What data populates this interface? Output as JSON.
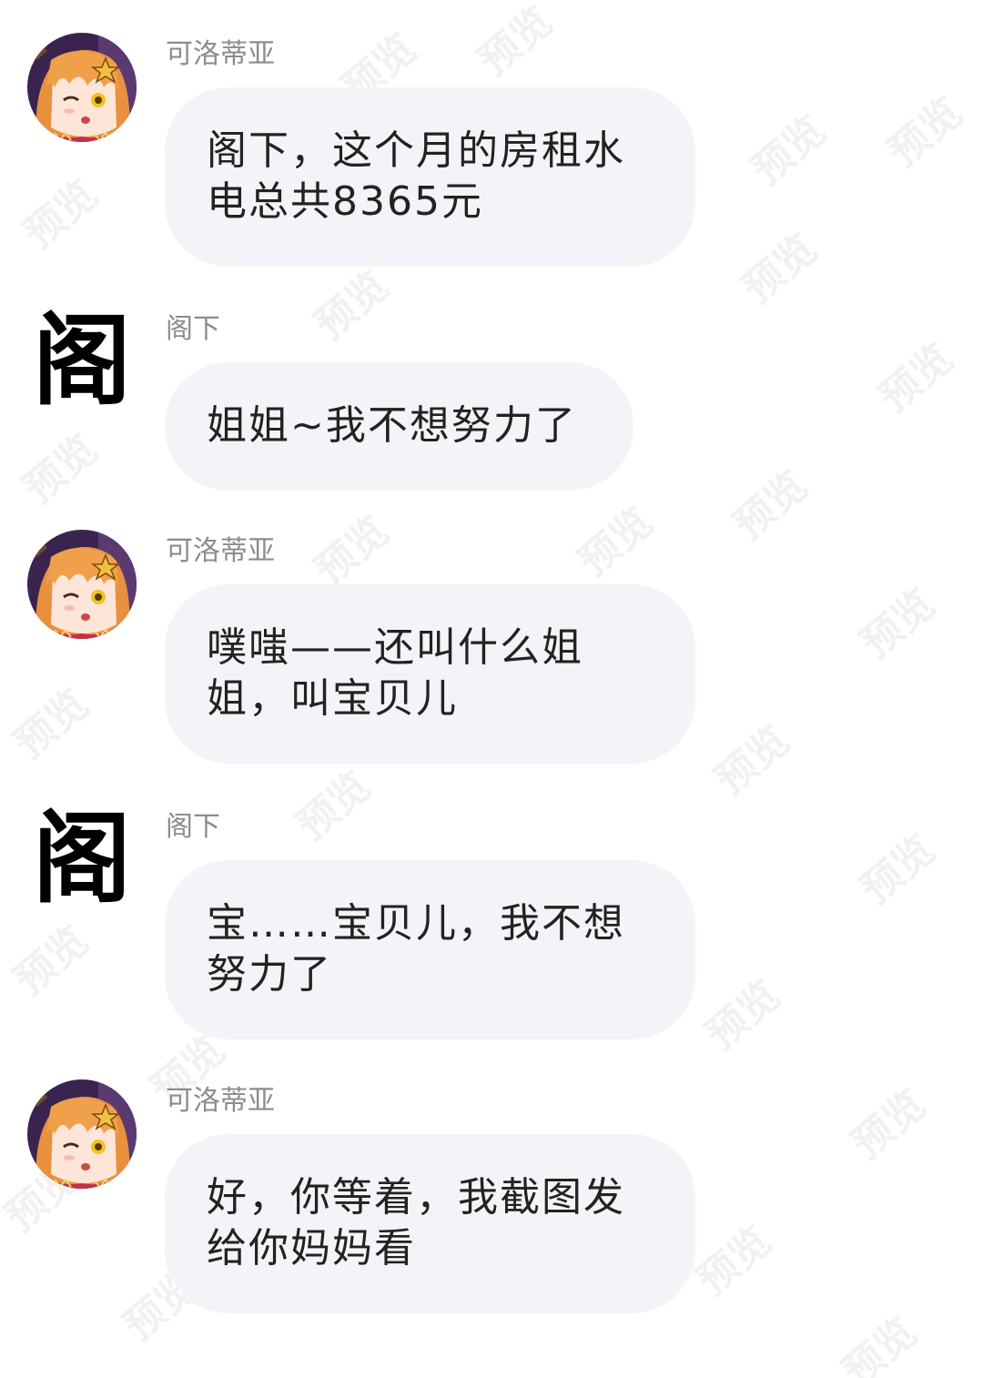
{
  "watermark": "预览",
  "messages": [
    {
      "sender": "可洛蒂亚",
      "avatar": "anime-girl-avatar",
      "text": "阁下，这个月的房租水\n电总共8365元"
    },
    {
      "sender": "阁下",
      "avatar_text": "阁",
      "text": "姐姐~我不想努力了"
    },
    {
      "sender": "可洛蒂亚",
      "avatar": "anime-girl-avatar",
      "text": "噗嗤——还叫什么姐\n姐，叫宝贝儿"
    },
    {
      "sender": "阁下",
      "avatar_text": "阁",
      "text": "宝……宝贝儿，我不想\n努力了"
    },
    {
      "sender": "可洛蒂亚",
      "avatar": "anime-girl-avatar",
      "text": "好，你等着，我截图发\n给你妈妈看"
    }
  ],
  "colors": {
    "bubble": "#f3f4f8",
    "sender": "#8c8c8c",
    "hair": "#e9903f",
    "avatar_bg": "#3b2350"
  }
}
